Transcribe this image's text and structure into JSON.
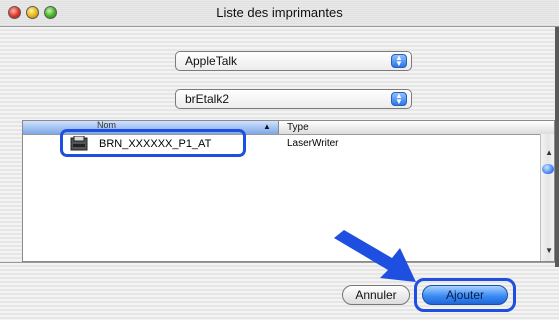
{
  "window": {
    "title": "Liste des imprimantes"
  },
  "popups": [
    {
      "value": "AppleTalk"
    },
    {
      "value": "brEtalk2"
    }
  ],
  "list": {
    "columns": {
      "name": "Nom",
      "type": "Type"
    },
    "rows": [
      {
        "name": "BRN_XXXXXX_P1_AT",
        "type": "LaserWriter"
      }
    ]
  },
  "buttons": {
    "cancel": "Annuler",
    "add": "Ajouter"
  },
  "colors": {
    "accent": "#1f4fe0",
    "default_button": "#3b8cf5"
  },
  "icons": [
    "close-icon",
    "minimize-icon",
    "zoom-icon",
    "popup-arrows-icon",
    "sort-ascending-icon",
    "printer-icon",
    "pointer-arrow-icon"
  ]
}
